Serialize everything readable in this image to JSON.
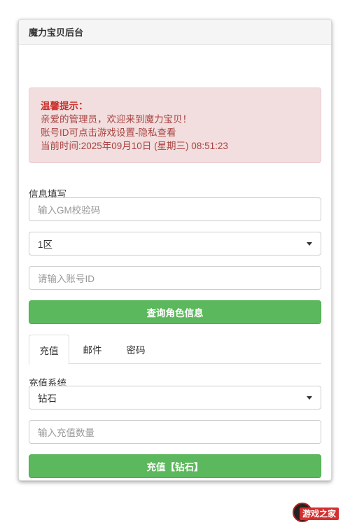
{
  "header": {
    "title": "魔力宝贝后台"
  },
  "alert": {
    "title": "温馨提示：",
    "line1": "亲爱的管理员，欢迎来到魔力宝贝！",
    "line2": "账号ID可点击游戏设置-隐私查看",
    "line3": "当前时间:2025年09月10日 (星期三) 08:51:23"
  },
  "info": {
    "label": "信息填写",
    "gm_code_placeholder": "输入GM校验码",
    "server_selected": "1区",
    "account_placeholder": "请输入账号ID",
    "query_button": "查询角色信息"
  },
  "tabs": [
    {
      "label": "充值",
      "active": true
    },
    {
      "label": "邮件",
      "active": false
    },
    {
      "label": "密码",
      "active": false
    }
  ],
  "recharge": {
    "label": "充值系统",
    "type_selected": "钻石",
    "amount_placeholder": "输入充值数量",
    "submit_button": "充值【钻石】"
  },
  "watermark": {
    "text": "游戏之家"
  },
  "colors": {
    "primary_green": "#5cb85c",
    "alert_bg": "#f2dede",
    "alert_text": "#a94442"
  }
}
